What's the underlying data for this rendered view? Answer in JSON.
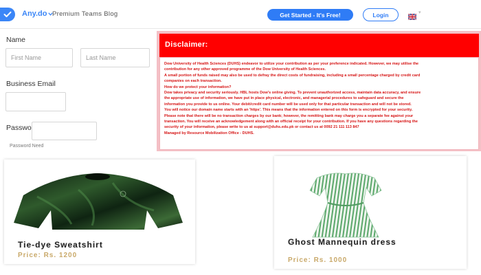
{
  "header": {
    "brand": "Any.do",
    "blog_title": "Premium Teams Blog",
    "cta_label": "Get Started - It's Free!",
    "login_label": "Login",
    "accent_color": "#2f7cf6",
    "icons": [
      "check-icon",
      "chevron-down-icon",
      "uk-flag-icon"
    ]
  },
  "form": {
    "name_label": "Name",
    "first_name_placeholder": "First Name",
    "last_name_placeholder": "Last Name",
    "email_label": "Business Email",
    "email_placeholder": "",
    "password_label": "Password",
    "password_placeholder": "",
    "password_hint": "Password Need"
  },
  "disclaimer": {
    "title": "Disclaimer:",
    "header_color": "#ff0000",
    "lines": [
      "Dow University of Health Sciences (DUHS) endeavor to utilize your contribution as per your preference indicated. However, we may utilise the",
      "contribution for any other approved programme of the Dow University of Health Sciences.",
      "A small portion of funds raised may also be used to defray the direct costs of fundraising, including a small percentage charged by credit card",
      "companies on each transaction.",
      "How do we protect your information?",
      "Dow takes privacy and security seriously. HBL hosts Dow's online giving. To prevent unauthorized access, maintain data accuracy, and ensure",
      "the appropriate use of information, we have put in place physical, electronic, and managerial procedures to safeguard and secure the",
      "information you provide to us online. Your debit/credit card number will be used only for that particular transaction and will not be stored.",
      "You will notice our domain name starts with an 'https'. This means that the information entered on this form is encrypted for your security.",
      "Please note that there will be no transaction charges by our bank; however, the remitting bank may charge you a separate fee against your",
      "transaction. You will receive an acknowledgement along with an official receipt for your contribution. If you have any questions regarding the",
      "security of your information, please write to us at support@duhs.edu.pk or contact us at 0092 21 111 113 847",
      "Managed by Resource Mobilization Office - DUHS."
    ]
  },
  "products": [
    {
      "name": "Tie-dye Sweatshirt",
      "price": "Price: Rs. 1200"
    },
    {
      "name": "Ghost Mannequin dress",
      "price": "Price: Rs. 1000"
    }
  ],
  "colors": {
    "price": "#c9a96a",
    "disclaimer_text": "#d61515"
  }
}
